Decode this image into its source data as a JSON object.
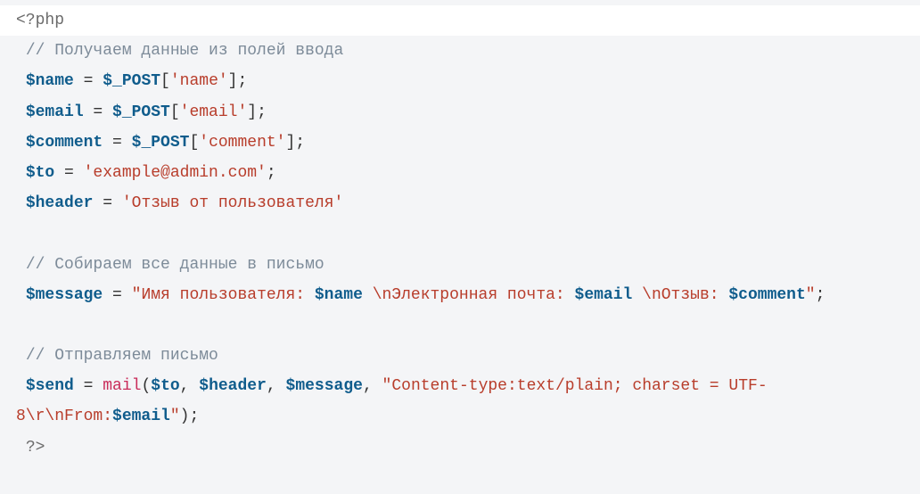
{
  "code": {
    "open_tag": "<?php",
    "comment1": "// Получаем данные из полей ввода",
    "l_name_var": "$name",
    "eq": " = ",
    "post": "$_POST",
    "lbr": "[",
    "rbr": "]",
    "semi": ";",
    "s_name": "'name'",
    "l_email_var": "$email",
    "s_email": "'email'",
    "l_comment_var": "$comment",
    "s_comment": "'comment'",
    "l_to_var": "$to",
    "s_to": "'example@admin.com'",
    "l_header_var": "$header",
    "s_header": "'Отзыв от пользователя'",
    "comment2": "// Собираем все данные в письмо",
    "l_message_var": "$message",
    "s_msg_p1": "\"Имя пользователя: ",
    "v_name": "$name",
    "s_msg_p2": " \\nЭлектронная почта: ",
    "v_email": "$email",
    "s_msg_p3": " \\nОтзыв: ",
    "v_comment": "$comment",
    "s_msg_p4": "\"",
    "comment3": "// Отправляем письмо",
    "l_send_var": "$send",
    "func_mail": "mail",
    "lpar": "(",
    "rpar": ")",
    "comma": ", ",
    "s_ct_p1": "\"Content-type:text/plain; charset = UTF-8\\r\\nFrom:",
    "s_ct_p2": "\"",
    "close_tag": "?>"
  }
}
